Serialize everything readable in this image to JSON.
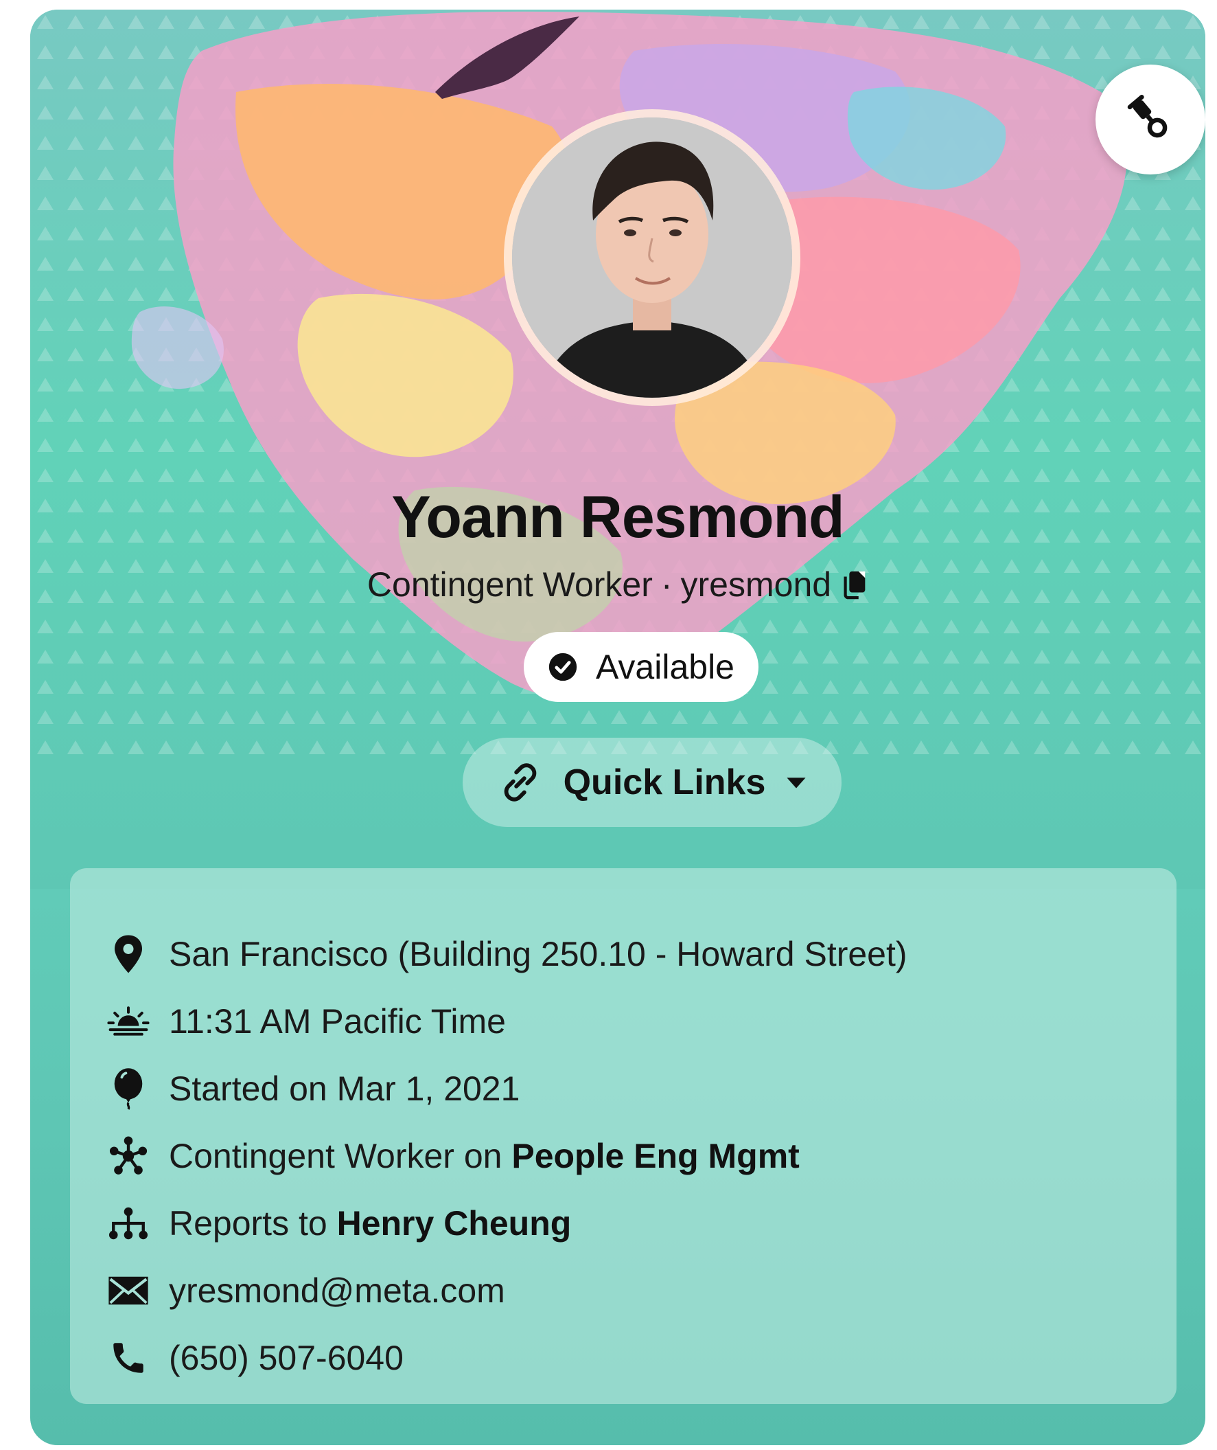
{
  "profile": {
    "name": "Yoann Resmond",
    "role": "Contingent Worker",
    "separator": "·",
    "username": "yresmond",
    "status": "Available",
    "quick_links_label": "Quick Links"
  },
  "details": {
    "location": "San Francisco (Building 250.10 - Howard Street)",
    "local_time": "11:31 AM Pacific Time",
    "start_date": "Started on Mar 1, 2021",
    "team_prefix": "Contingent Worker on",
    "team_name": "People Eng Mgmt",
    "reports_prefix": "Reports to",
    "manager": "Henry Cheung",
    "email": "yresmond@meta.com",
    "phone": "(650) 507-6040"
  },
  "icons": {
    "theme": "paintbrush-icon",
    "copy": "copy-icon",
    "status": "check-circle-icon",
    "quick_links": "link-icon",
    "dropdown": "caret-down-icon",
    "location": "map-pin-icon",
    "time": "sunrise-icon",
    "start": "balloon-icon",
    "team": "team-hub-icon",
    "reports": "org-chart-icon",
    "email": "envelope-icon",
    "phone": "phone-icon"
  },
  "colors": {
    "card_teal": "#5ecfb8",
    "panel_tint": "#c8eee6",
    "text_dark": "#111111",
    "pill_white": "#ffffff"
  }
}
